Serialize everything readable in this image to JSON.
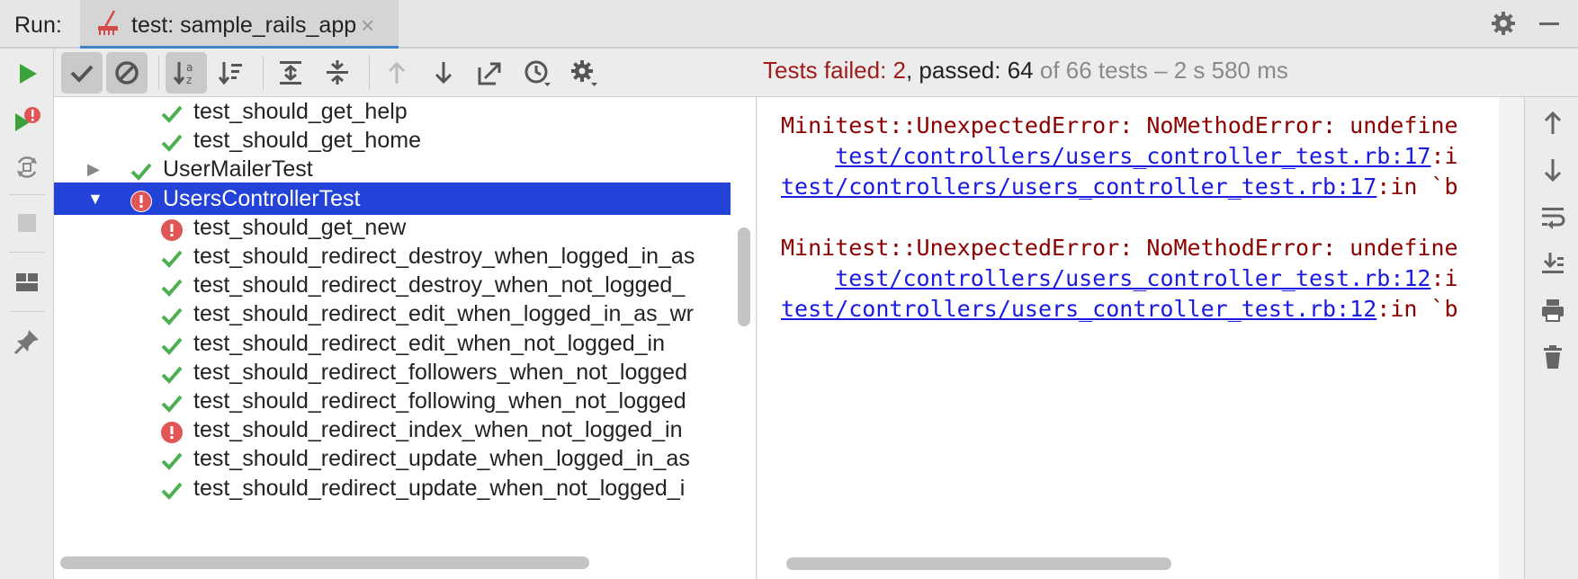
{
  "titlebar": {
    "run_label": "Run:",
    "tab_label": "test: sample_rails_app",
    "tab_close": "×"
  },
  "toolbar": {
    "icons": [
      "check-icon",
      "cancel-icon",
      "sort-alpha-icon",
      "sort-duration-icon",
      "expand-all-icon",
      "collapse-all-icon",
      "previous-failed-icon",
      "next-failed-icon",
      "export-icon",
      "history-icon",
      "settings-icon"
    ]
  },
  "status": {
    "failed": "Tests failed: 2",
    "passed": ", passed: 64",
    "total": " of 66 tests – 2 s 580 ms"
  },
  "tree": {
    "rows": [
      {
        "label": "test_should_get_help",
        "status": "passed",
        "level": 2,
        "expander": ""
      },
      {
        "label": "test_should_get_home",
        "status": "passed",
        "level": 2,
        "expander": ""
      },
      {
        "label": "UserMailerTest",
        "status": "passed",
        "level": 1,
        "expander": "▶"
      },
      {
        "label": "UsersControllerTest",
        "status": "failed",
        "level": 1,
        "expander": "▼",
        "selected": true
      },
      {
        "label": "test_should_get_new",
        "status": "failed",
        "level": 2,
        "expander": ""
      },
      {
        "label": "test_should_redirect_destroy_when_logged_in_as",
        "status": "passed",
        "level": 2,
        "expander": ""
      },
      {
        "label": "test_should_redirect_destroy_when_not_logged_",
        "status": "passed",
        "level": 2,
        "expander": ""
      },
      {
        "label": "test_should_redirect_edit_when_logged_in_as_wr",
        "status": "passed",
        "level": 2,
        "expander": ""
      },
      {
        "label": "test_should_redirect_edit_when_not_logged_in",
        "status": "passed",
        "level": 2,
        "expander": ""
      },
      {
        "label": "test_should_redirect_followers_when_not_logged",
        "status": "passed",
        "level": 2,
        "expander": ""
      },
      {
        "label": "test_should_redirect_following_when_not_logged",
        "status": "passed",
        "level": 2,
        "expander": ""
      },
      {
        "label": "test_should_redirect_index_when_not_logged_in",
        "status": "failed",
        "level": 2,
        "expander": ""
      },
      {
        "label": "test_should_redirect_update_when_logged_in_as",
        "status": "passed",
        "level": 2,
        "expander": ""
      },
      {
        "label": "test_should_redirect_update_when_not_logged_i",
        "status": "passed",
        "level": 2,
        "expander": ""
      }
    ]
  },
  "console": {
    "lines": [
      {
        "prefix": "Minitest::UnexpectedError: NoMethodError: undefine",
        "link": "",
        "tail": ""
      },
      {
        "prefix": "    ",
        "link": "test/controllers/users_controller_test.rb:17",
        "tail": ":i"
      },
      {
        "prefix": "",
        "link": "test/controllers/users_controller_test.rb:17",
        "tail": ":in `b"
      },
      {
        "prefix": "",
        "link": "",
        "tail": ""
      },
      {
        "prefix": "Minitest::UnexpectedError: NoMethodError: undefine",
        "link": "",
        "tail": ""
      },
      {
        "prefix": "    ",
        "link": "test/controllers/users_controller_test.rb:12",
        "tail": ":i"
      },
      {
        "prefix": "",
        "link": "test/controllers/users_controller_test.rb:12",
        "tail": ":in `b"
      }
    ]
  },
  "colors": {
    "passed": "#4caf50",
    "failed": "#e05555",
    "selection": "#2342d8",
    "run_green": "#3ca33c"
  }
}
